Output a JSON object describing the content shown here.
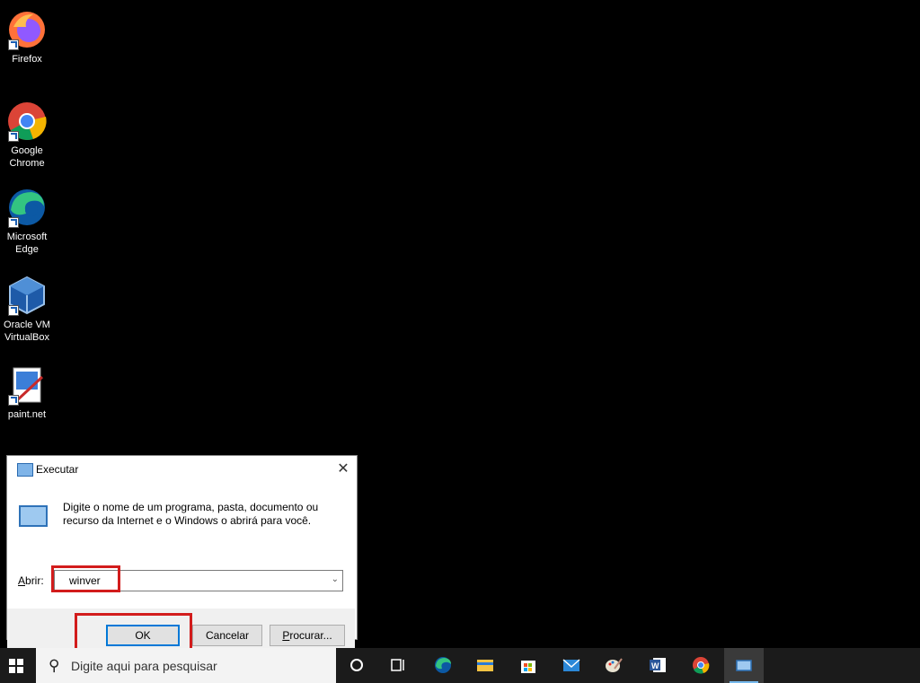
{
  "desktop": {
    "icons": [
      {
        "label_lines": [
          "Firefox"
        ],
        "icon": "firefox-icon"
      },
      {
        "label_lines": [
          "Google",
          "Chrome"
        ],
        "icon": "chrome-icon"
      },
      {
        "label_lines": [
          "Microsoft",
          "Edge"
        ],
        "icon": "edge-icon"
      },
      {
        "label_lines": [
          "Oracle VM",
          "VirtualBox"
        ],
        "icon": "virtualbox-icon"
      },
      {
        "label_lines": [
          "paint.net"
        ],
        "icon": "paintnet-icon"
      }
    ]
  },
  "run_dialog": {
    "title": "Executar",
    "description": "Digite o nome de um programa, pasta, documento ou recurso da Internet e o Windows o abrirá para você.",
    "open_label_prefix": "A",
    "open_label_rest": "brir:",
    "input_value": "winver",
    "ok_label": "OK",
    "cancel_label": "Cancelar",
    "browse_label_prefix": "P",
    "browse_label_rest": "rocurar...",
    "close_glyph": "✕"
  },
  "taskbar": {
    "search_placeholder": "Digite aqui para pesquisar",
    "apps": [
      "cortana-icon",
      "task-view-icon",
      "edge-icon",
      "file-explorer-icon",
      "store-icon",
      "mail-icon",
      "paint-icon",
      "word-icon",
      "chrome-icon",
      "run-icon"
    ]
  },
  "colors": {
    "highlight": "#d21c1c",
    "accent": "#0078d7",
    "taskbar": "#1b1b1b"
  }
}
